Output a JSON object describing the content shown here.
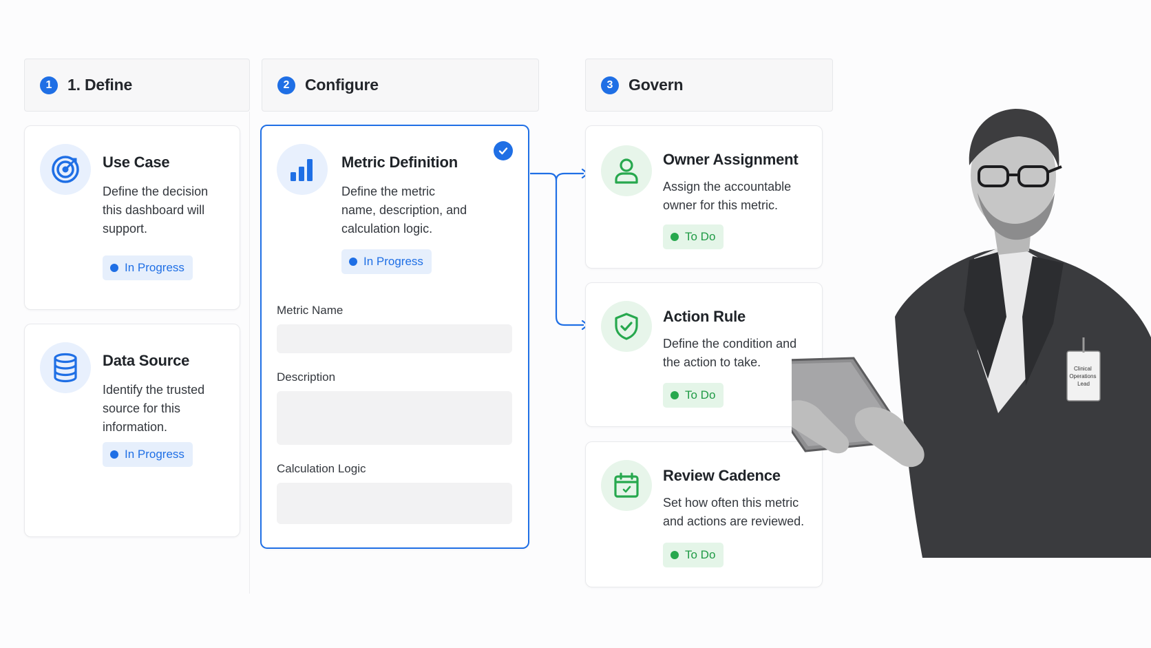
{
  "colors": {
    "accent_blue": "#1f6fe5",
    "accent_green": "#27a84e",
    "blue_bg": "#e8f0fd",
    "green_bg": "#e7f5ea"
  },
  "columns": [
    {
      "number": "1",
      "title": "1. Define"
    },
    {
      "number": "2",
      "title": "Configure"
    },
    {
      "number": "3",
      "title": "Govern"
    }
  ],
  "define": {
    "use_case": {
      "icon": "target-icon",
      "title": "Use Case",
      "description": "Define the decision this dashboard will support.",
      "status": "In Progress"
    },
    "data_source": {
      "icon": "database-icon",
      "title": "Data Source",
      "description": "Identify the trusted source for this information.",
      "status": "In Progress"
    }
  },
  "configure": {
    "metric_definition": {
      "icon": "bar-chart-icon",
      "title": "Metric Definition",
      "description": "Define the metric name, description, and calculation logic.",
      "status": "In Progress",
      "completed_icon": "check-icon",
      "fields": {
        "metric_name_label": "Metric Name",
        "metric_name_value": "",
        "description_label": "Description",
        "description_value": "",
        "calculation_logic_label": "Calculation Logic",
        "calculation_logic_value": ""
      }
    }
  },
  "govern": {
    "owner_assignment": {
      "icon": "user-icon",
      "title": "Owner Assignment",
      "description": "Assign the accountable owner for this metric.",
      "status": "To Do"
    },
    "action_rule": {
      "icon": "shield-check-icon",
      "title": "Action Rule",
      "description": "Define the condition and the action to take.",
      "status": "To Do"
    },
    "review_cadence": {
      "icon": "calendar-icon",
      "title": "Review Cadence",
      "description": "Set how often this metric and actions are reviewed.",
      "status": "To Do"
    }
  },
  "person": {
    "badge_text": "Clinical Operations Lead"
  }
}
